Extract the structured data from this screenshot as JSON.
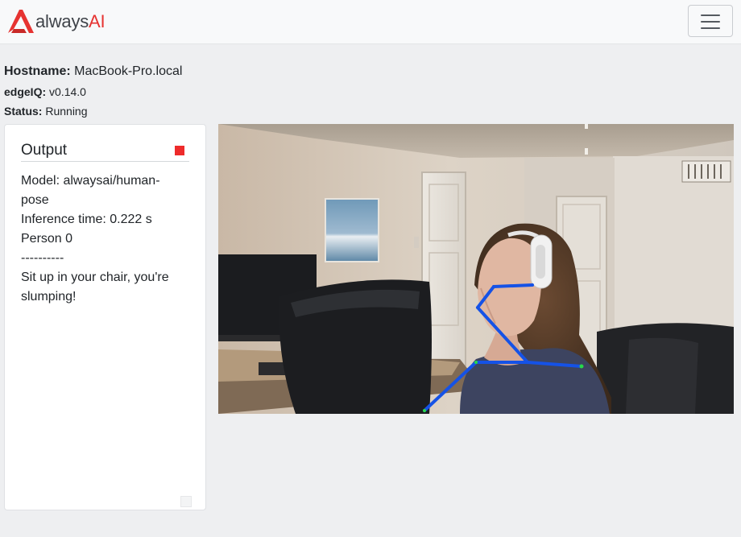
{
  "navbar": {
    "brand": {
      "prefix": "always",
      "suffix": "AI"
    },
    "menu_toggle": {
      "icon": "hamburger-menu-icon"
    }
  },
  "info": {
    "hostname_label": "Hostname:",
    "hostname_value": "MacBook-Pro.local",
    "edgeiq_label": "edgeIQ:",
    "edgeiq_value": "v0.14.0",
    "status_label": "Status:",
    "status_value": "Running"
  },
  "output": {
    "title": "Output",
    "stop_icon": "stop-icon",
    "lines": [
      "Model: alwaysai/human-pose",
      "Inference time: 0.222 s",
      "Person 0",
      "----------",
      "Sit up in your chair, you're slumping!"
    ]
  },
  "video": {
    "description_icon": "video-stream-icon",
    "colors": {
      "skeleton": "#1552e6",
      "keypoint": "#27d84a",
      "stop": "#ee2b2b",
      "brand_red": "#e63331"
    }
  }
}
